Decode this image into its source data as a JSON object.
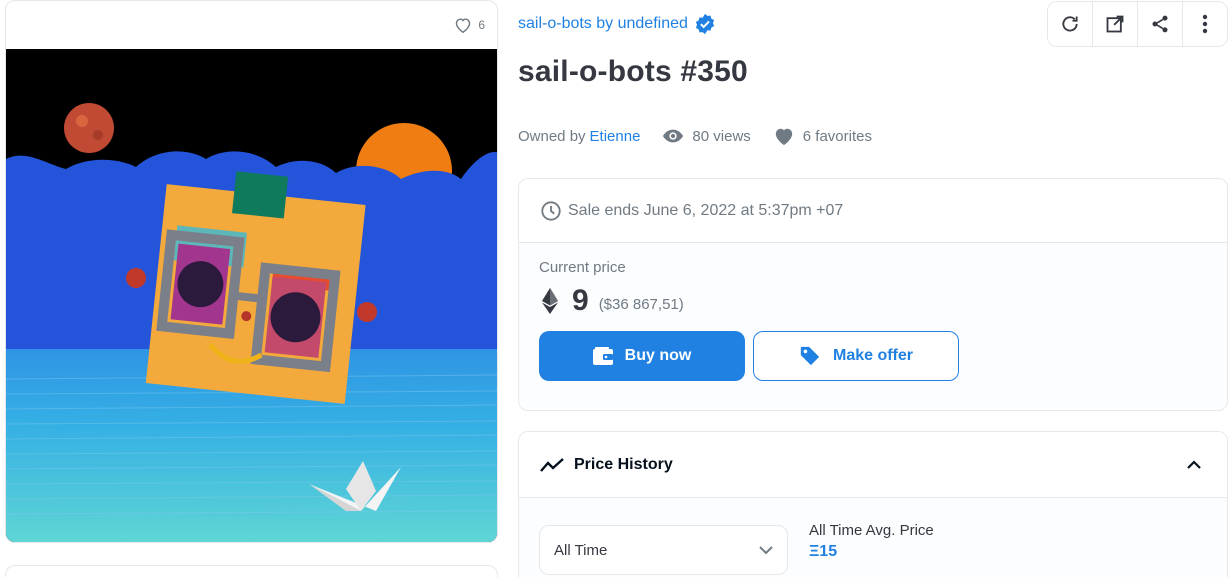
{
  "media": {
    "favorites_count": "6"
  },
  "collection": {
    "name": "sail-o-bots by undefined",
    "verified": true
  },
  "item": {
    "title": "sail-o-bots #350"
  },
  "meta": {
    "owned_by_label": "Owned by",
    "owner": "Etienne",
    "views": "80 views",
    "favorites": "6 favorites"
  },
  "actions": {
    "icons": [
      "refresh-icon",
      "external-link-icon",
      "share-icon",
      "more-vertical-icon"
    ]
  },
  "sale": {
    "ends_text": "Sale ends June 6, 2022 at 5:37pm +07",
    "current_price_label": "Current price",
    "price": "9",
    "price_usd": "($36 867,51)",
    "buy_label": "Buy now",
    "offer_label": "Make offer"
  },
  "price_history": {
    "title": "Price History",
    "time_filter": "All Time",
    "avg_label": "All Time Avg. Price",
    "avg_value": "Ξ15"
  },
  "colors": {
    "accent": "#2081e2",
    "text": "#353840",
    "muted": "#707a83",
    "border": "#e5e8eb"
  }
}
